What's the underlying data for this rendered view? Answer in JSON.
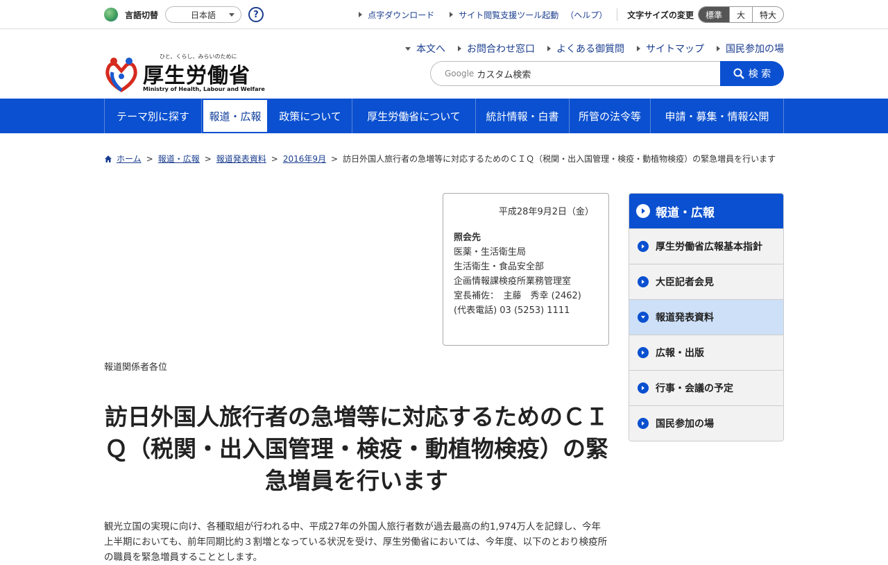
{
  "utility": {
    "lang_label": "言語切替",
    "lang_value": "日本語",
    "help_symbol": "?",
    "links": [
      "点字ダウンロード",
      "サイト閲覧支援ツール起動"
    ],
    "help_paren": "（ヘルプ）",
    "font_size_label": "文字サイズの変更",
    "font_sizes": [
      "標準",
      "大",
      "特大"
    ]
  },
  "logo": {
    "tagline": "ひと、くらし、みらいのために",
    "name": "厚生労働省",
    "english": "Ministry of Health, Labour and Welfare"
  },
  "header_nav": [
    "本文へ",
    "お問合わせ窓口",
    "よくある御質問",
    "サイトマップ",
    "国民参加の場"
  ],
  "search": {
    "google": "Google",
    "placeholder": "カスタム検索",
    "button": "検 索"
  },
  "global_nav": [
    {
      "label": "テーマ別に探す"
    },
    {
      "label": "報道・広報"
    },
    {
      "label": "政策について"
    },
    {
      "label": "厚生労働省について"
    },
    {
      "label": "統計情報・白書"
    },
    {
      "label": "所管の法令等"
    },
    {
      "label": "申請・募集・情報公開"
    }
  ],
  "breadcrumb": {
    "links": [
      "ホーム",
      "報道・広報",
      "報道発表資料",
      "2016年9月"
    ],
    "current": "訪日外国人旅行者の急増等に対応するためのＣＩＱ（税関・出入国管理・検疫・動植物検疫）の緊急増員を行います",
    "separator": ">"
  },
  "contact": {
    "date": "平成28年9月2日（金）",
    "title": "照会先",
    "lines": [
      "医薬・生活衛生局",
      "生活衛生・食品安全部",
      "企画情報課検疫所業務管理室",
      "室長補佐：　主藤　秀幸 (2462)",
      "(代表電話) 03 (5253) 1111"
    ]
  },
  "recipients": "報道関係者各位",
  "headline": "訪日外国人旅行者の急増等に対応するためのＣＩＱ（税関・出入国管理・検疫・動植物検疫）の緊急増員を行います",
  "body": "観光立国の実現に向け、各種取組が行われる中、平成27年の外国人旅行者数が過去最高の約1,974万人を記録し、今年上半期においても、前年同期比約３割増となっている状況を受け、厚生労働省においては、今年度、以下のとおり検疫所の職員を緊急増員することとします。",
  "side_menu": {
    "title": "報道・広報",
    "items": [
      {
        "label": "厚生労働省広報基本指針"
      },
      {
        "label": "大臣記者会見"
      },
      {
        "label": "報道発表資料"
      },
      {
        "label": "広報・出版"
      },
      {
        "label": "行事・会議の予定"
      },
      {
        "label": "国民参加の場"
      }
    ]
  },
  "colors": {
    "primary": "#0a50d0",
    "link": "#1a3d8f",
    "active_side": "#cde0f8"
  }
}
